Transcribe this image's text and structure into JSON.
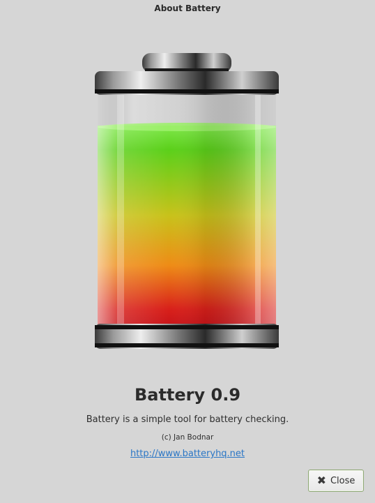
{
  "window": {
    "title": "About Battery"
  },
  "about": {
    "program_name": "Battery 0.9",
    "comments": "Battery is a simple tool for battery checking.",
    "copyright": "(c) Jan Bodnar",
    "website": "http://www.batteryhq.net"
  },
  "buttons": {
    "close_label": "Close",
    "close_icon": "close-icon"
  },
  "logo": {
    "icon": "battery-icon",
    "charge_colors": [
      "#5cd41a",
      "#e88a12",
      "#d9211a"
    ]
  }
}
